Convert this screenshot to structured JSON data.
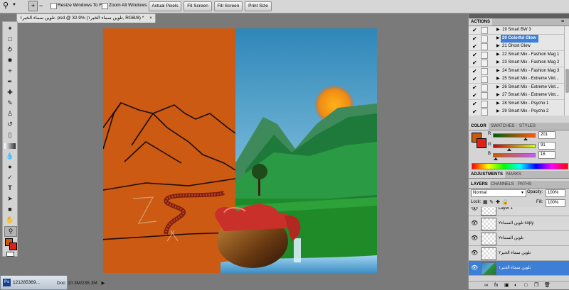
{
  "options_bar": {
    "resize_windows_label": "Resize Windows To Fit",
    "zoom_all_label": "Zoom All Windows",
    "actual_pixels": "Actual Pixels",
    "fit_screen": "Fit Screen",
    "fill_screen": "Fill Screen",
    "print_size": "Print Size"
  },
  "document": {
    "tab_title": "تلوين سماء الخير١. psd @ 32.9% (تلوين سماء الخير١, RGB/8) *",
    "close_glyph": "×"
  },
  "actions_panel": {
    "title": "ACTIONS",
    "items": [
      {
        "label": "19 Smart BW 3",
        "selected": false
      },
      {
        "label": "20 Colorful Glow",
        "selected": true
      },
      {
        "label": "21 Ghost Glow",
        "selected": false
      },
      {
        "label": "22 Smart Mix - Fashion Mag 1",
        "selected": false
      },
      {
        "label": "23 Smart Mix - Fashion Mag 2",
        "selected": false
      },
      {
        "label": "24 Smart Mix - Fashion Mag 3",
        "selected": false
      },
      {
        "label": "25 Smart Mix - Extreme Vint...",
        "selected": false
      },
      {
        "label": "26 Smart Mix - Extreme Vint...",
        "selected": false
      },
      {
        "label": "27 Smart Mix - Extreme Vint...",
        "selected": false
      },
      {
        "label": "28 Smart Mix - Psycho 1",
        "selected": false
      },
      {
        "label": "29 Smart Mix - Psycho 2",
        "selected": false
      }
    ]
  },
  "color_panel": {
    "tabs": [
      "COLOR",
      "SWATCHES",
      "STYLES"
    ],
    "r_label": "R",
    "g_label": "G",
    "b_label": "B",
    "r_value": "201",
    "g_value": "91",
    "b_value": "16",
    "r": 201,
    "g": 91,
    "b": 16,
    "foreground_color": "#c95b10",
    "background_color": "#e0201a"
  },
  "adjustments_panel": {
    "tabs": [
      "ADJUSTMENTS",
      "MASKS"
    ]
  },
  "layers_panel": {
    "tabs": [
      "LAYERS",
      "CHANNELS",
      "PATHS"
    ],
    "blend_mode": "Normal",
    "opacity_label": "Opacity:",
    "opacity_value": "100%",
    "fill_label": "Fill:",
    "fill_value": "100%",
    "lock_label": "Lock:",
    "layers": [
      {
        "name": "Layer 1",
        "selected": false
      },
      {
        "name": "تلوين السماء٢ copy",
        "selected": false
      },
      {
        "name": "تلوين السماء٢",
        "selected": false
      },
      {
        "name": "تلوين سماء الخير٢",
        "selected": false
      },
      {
        "name": "تلوين سماء الخير١",
        "selected": true
      }
    ]
  },
  "status": {
    "doc_size": "Doc: 10.3M/235.3M"
  },
  "taskbar": {
    "item_label": "121285369..."
  }
}
